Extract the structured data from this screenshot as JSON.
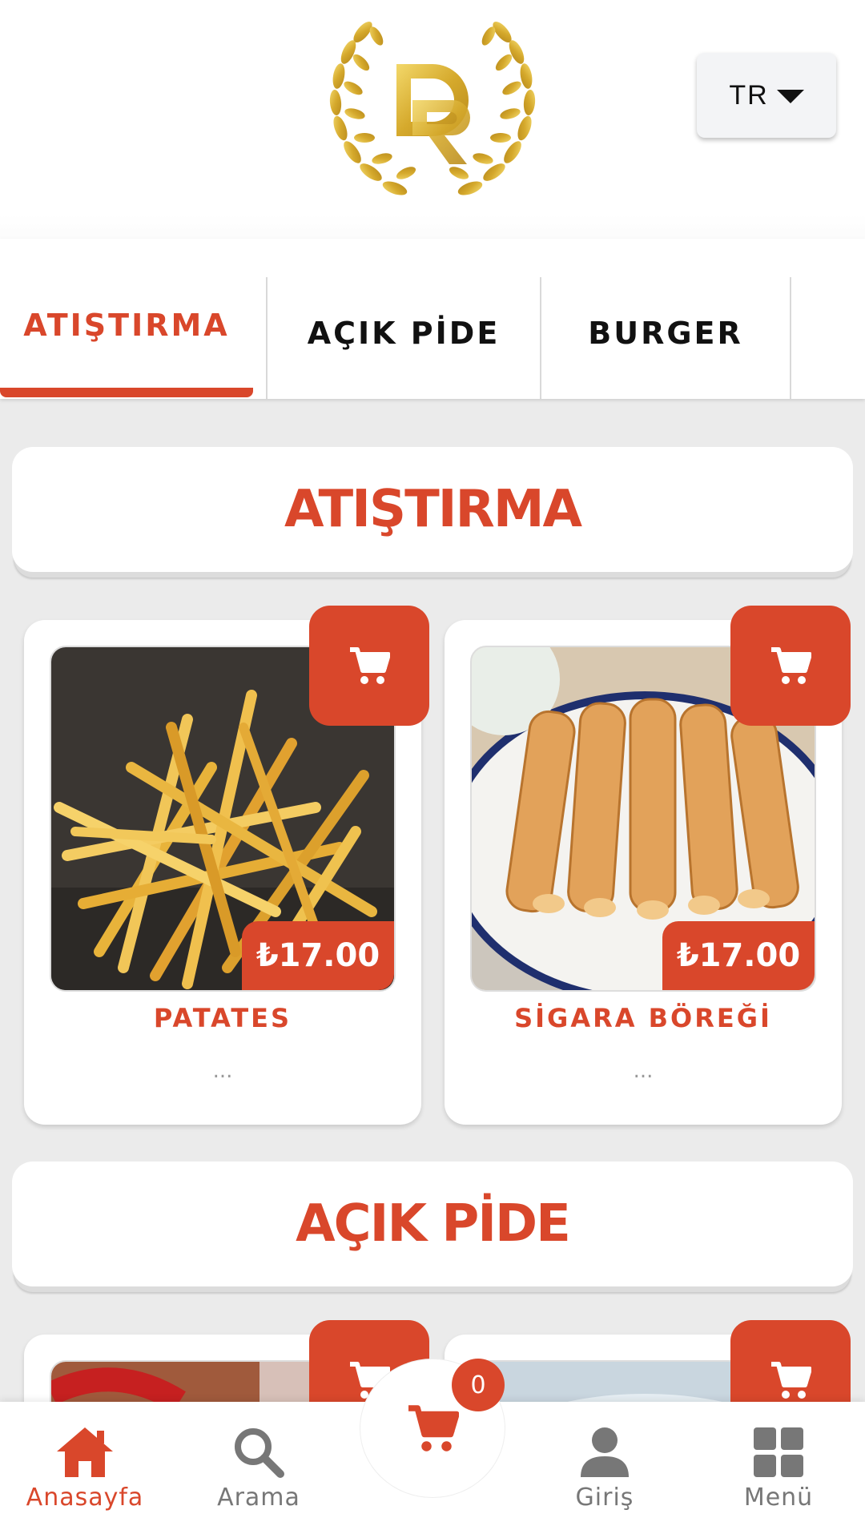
{
  "brand": {
    "logo_letters": "DR",
    "accent": "#d9472b",
    "gold": "#d9b43a"
  },
  "language": {
    "selected": "TR",
    "icon": "caret-down-icon"
  },
  "tabs": [
    {
      "label": "ATIŞTIRMA",
      "active": true
    },
    {
      "label": "AÇIK PİDE",
      "active": false
    },
    {
      "label": "BURGER",
      "active": false
    }
  ],
  "sections": [
    {
      "title": "ATIŞTIRMA"
    },
    {
      "title": "AÇIK PİDE"
    }
  ],
  "products": [
    {
      "name": "PATATES",
      "price": "₺17.00",
      "description": "..."
    },
    {
      "name": "SİGARA BÖREĞİ",
      "price": "₺17.00",
      "description": "..."
    }
  ],
  "bottom_nav": {
    "home": {
      "label": "Anasayfa",
      "icon": "home-icon"
    },
    "search": {
      "label": "Arama",
      "icon": "search-icon"
    },
    "cart": {
      "count": "0",
      "icon": "cart-icon"
    },
    "login": {
      "label": "Giriş",
      "icon": "user-icon"
    },
    "menu": {
      "label": "Menü",
      "icon": "grid-icon"
    }
  }
}
